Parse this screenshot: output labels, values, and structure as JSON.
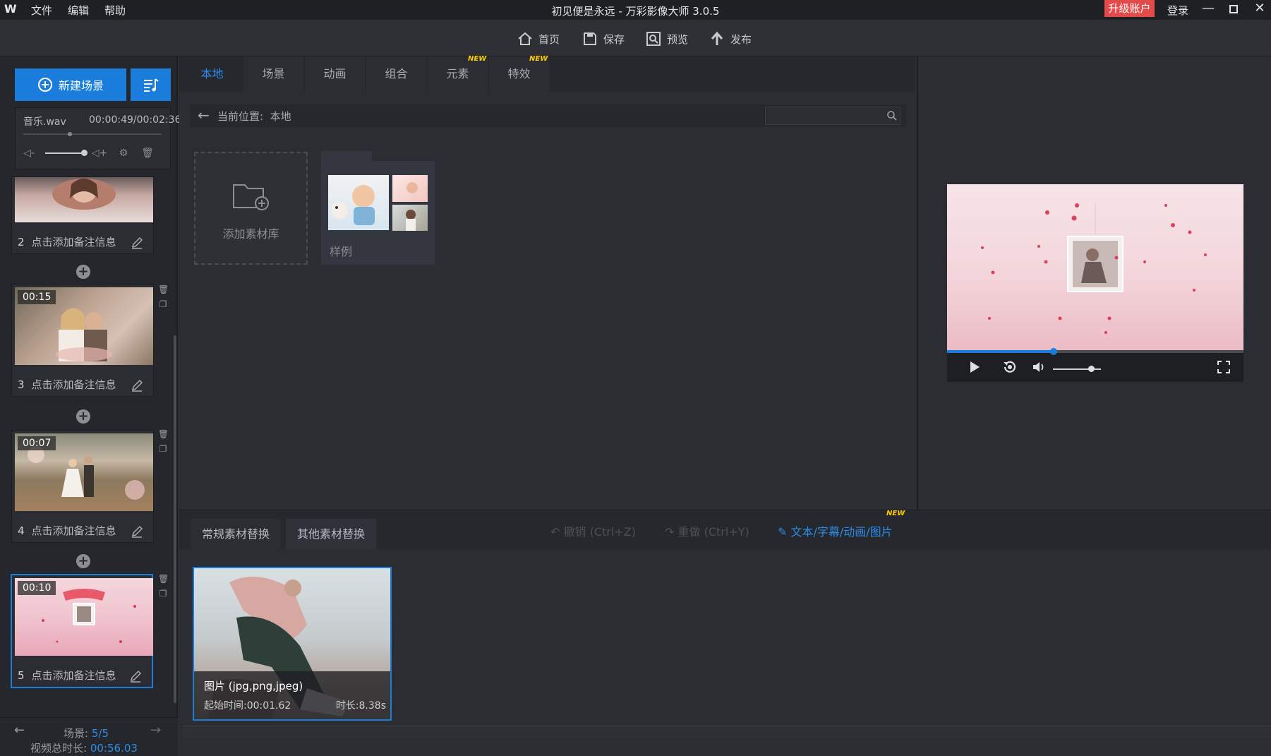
{
  "titlebar": {
    "logo": "W",
    "menu": [
      "文件",
      "编辑",
      "帮助"
    ],
    "title": "初见便是永远 - 万彩影像大师 3.0.5",
    "upgrade": "升级账户",
    "login": "登录"
  },
  "toolbar": {
    "home": "首页",
    "save": "保存",
    "preview": "预览",
    "publish": "发布"
  },
  "left": {
    "new_scene": "新建场景",
    "music": {
      "name": "音乐.wav",
      "time": "00:00:49/00:02:36"
    },
    "scenes": [
      {
        "num": "2",
        "time": "",
        "note": "点击添加备注信息"
      },
      {
        "num": "3",
        "time": "00:15",
        "note": "点击添加备注信息"
      },
      {
        "num": "4",
        "time": "00:07",
        "note": "点击添加备注信息"
      },
      {
        "num": "5",
        "time": "00:10",
        "note": "点击添加备注信息"
      }
    ],
    "footer": {
      "scene_label": "场景:",
      "scene_value": "5/5",
      "duration_label": "视频总时长:",
      "duration_value": "00:56.03"
    }
  },
  "tabs": {
    "items": [
      "本地",
      "场景",
      "动画",
      "组合",
      "元素",
      "特效"
    ],
    "active": "本地",
    "badge": "NEW"
  },
  "path": {
    "label": "当前位置:",
    "value": "本地"
  },
  "library": {
    "add_label": "添加素材库",
    "sample_label": "样例"
  },
  "bottom": {
    "tab_regular": "常规素材替换",
    "tab_other": "其他素材替换",
    "undo": "撤销 (Ctrl+Z)",
    "redo": "重做 (Ctrl+Y)",
    "text_sub": "文本/字幕/动画/图片",
    "badge": "NEW",
    "card": {
      "type": "图片 (jpg,png,jpeg)",
      "start": "起始时间:00:01.62",
      "duration": "时长:8.38s"
    }
  },
  "player": {
    "progress": 0.36,
    "volume": 0.8
  },
  "colors": {
    "accent": "#1a7ddb",
    "upgrade": "#e34b4b",
    "badge": "#ffcc00"
  }
}
